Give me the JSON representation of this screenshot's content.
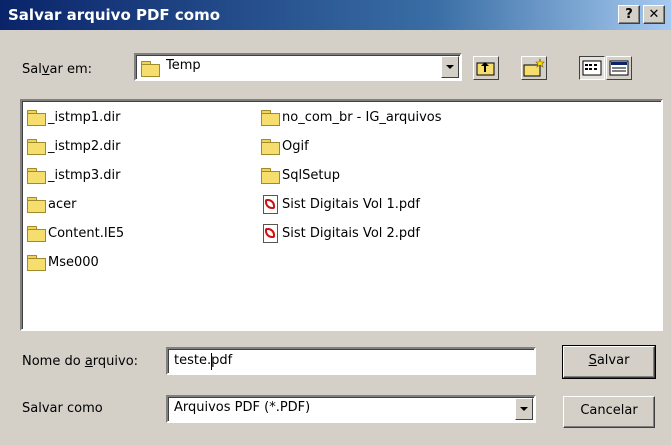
{
  "window": {
    "title": "Salvar arquivo PDF como",
    "help_label": "?",
    "close_label": "✕"
  },
  "save_in": {
    "label_prefix": "Sal",
    "label_accel": "v",
    "label_suffix": "ar em:",
    "value": "Temp"
  },
  "toolbar": {
    "icons": [
      "up-one-level-icon",
      "create-new-folder-icon",
      "list-view-icon",
      "details-view-icon"
    ]
  },
  "files": {
    "column1": [
      "_istmp1.dir",
      "_istmp2.dir",
      "_istmp3.dir",
      "acer",
      "Content.IE5",
      "Mse000"
    ],
    "column2": [
      "no_com_br - IG_arquivos",
      "Ogif",
      "SqlSetup",
      "Sist Digitais Vol 1.pdf",
      "Sist Digitais Vol 2.pdf"
    ]
  },
  "filename": {
    "label_prefix": "Nome do ",
    "label_accel": "a",
    "label_suffix": "rquivo:",
    "value": "teste.pdf"
  },
  "save_as_type": {
    "label": "Salvar como",
    "value": "Arquivos PDF (*.PDF)"
  },
  "buttons": {
    "save_accel": "S",
    "save_rest": "alvar",
    "cancel": "Cancelar"
  }
}
